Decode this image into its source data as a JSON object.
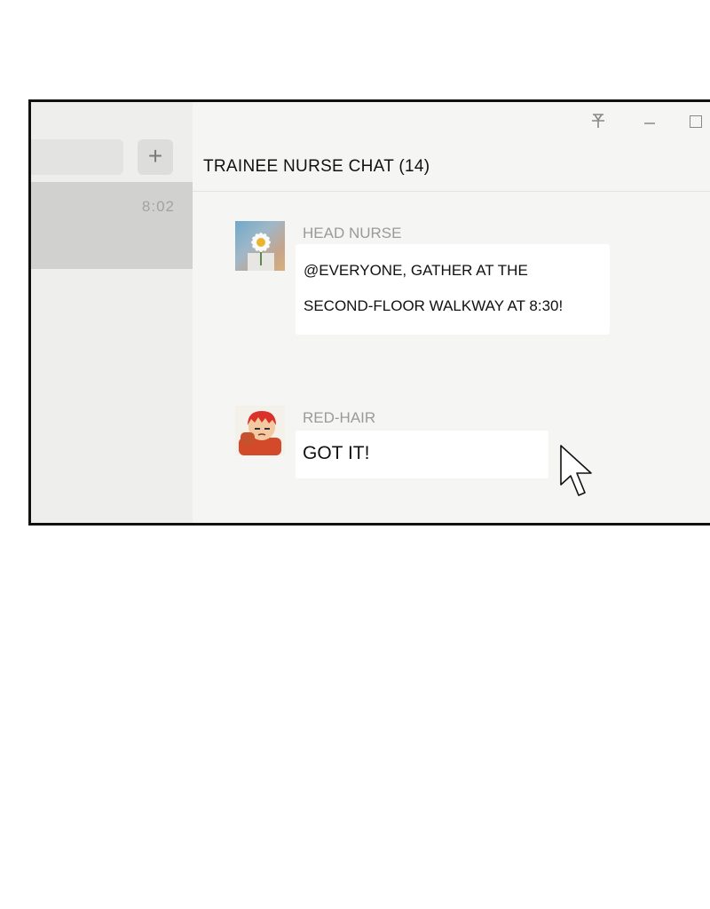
{
  "sidebar": {
    "add_label": "+",
    "conversation": {
      "time": "8:02"
    }
  },
  "header": {
    "title": "TRAINEE NURSE CHAT (14)",
    "icons": [
      "pin-icon",
      "minimize-icon",
      "maximize-icon"
    ]
  },
  "messages": [
    {
      "sender": "HEAD NURSE",
      "avatar": "flower-avatar",
      "lines": [
        "@EVERYONE, GATHER AT THE",
        "SECOND-FLOOR WALKWAY AT 8:30!"
      ]
    },
    {
      "sender": "RED-HAIR",
      "avatar": "red-hair-avatar",
      "lines": [
        "GOT IT!"
      ]
    }
  ],
  "colors": {
    "sidebar": "#eeeeed",
    "selected_conversation": "#d1d1d0",
    "chat_background": "#f5f5f4",
    "bubble": "#ffffff",
    "sender_name": "#9a9a9a"
  }
}
